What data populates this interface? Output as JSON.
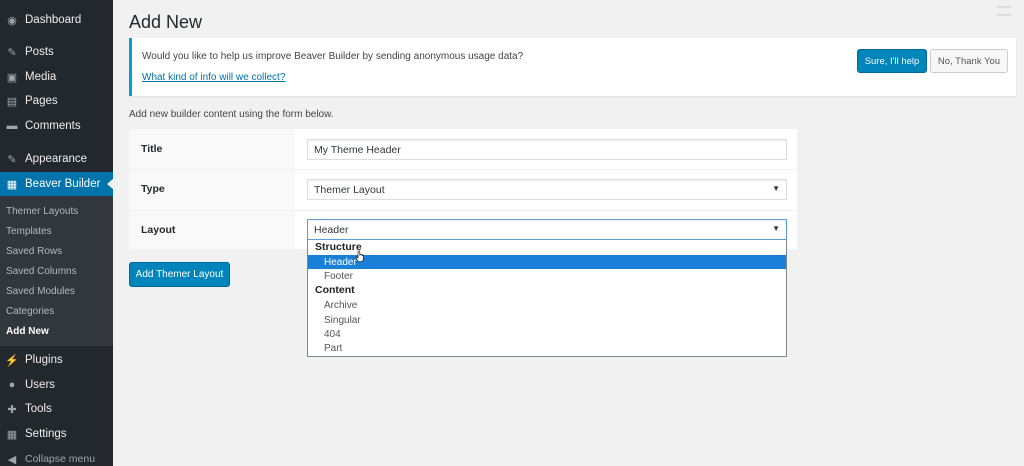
{
  "sidebar": {
    "items": [
      {
        "label": "Dashboard",
        "icon": "dashboard-icon",
        "glyph": "◉"
      },
      {
        "label": "Posts",
        "icon": "pin-icon",
        "glyph": "✎"
      },
      {
        "label": "Media",
        "icon": "media-icon",
        "glyph": "▣"
      },
      {
        "label": "Pages",
        "icon": "pages-icon",
        "glyph": "▤"
      },
      {
        "label": "Comments",
        "icon": "comment-icon",
        "glyph": "▬"
      },
      {
        "label": "Appearance",
        "icon": "brush-icon",
        "glyph": "✎"
      },
      {
        "label": "Beaver Builder",
        "icon": "calendar-icon",
        "glyph": "▦"
      },
      {
        "label": "Plugins",
        "icon": "plug-icon",
        "glyph": "⚡"
      },
      {
        "label": "Users",
        "icon": "user-icon",
        "glyph": "●"
      },
      {
        "label": "Tools",
        "icon": "wrench-icon",
        "glyph": "✚"
      },
      {
        "label": "Settings",
        "icon": "settings-icon",
        "glyph": "▦"
      }
    ],
    "submenu": [
      {
        "label": "Themer Layouts"
      },
      {
        "label": "Templates"
      },
      {
        "label": "Saved Rows"
      },
      {
        "label": "Saved Columns"
      },
      {
        "label": "Saved Modules"
      },
      {
        "label": "Categories"
      },
      {
        "label": "Add New"
      }
    ],
    "collapse_label": "Collapse menu",
    "collapse_glyph": "◀"
  },
  "page": {
    "title": "Add New"
  },
  "notice": {
    "text": "Would you like to help us improve Beaver Builder by sending anonymous usage data?",
    "link": "What kind of info will we collect?",
    "sure_label": "Sure, I'll help",
    "no_label": "No, Thank You"
  },
  "form": {
    "intro": "Add new builder content using the form below.",
    "title_label": "Title",
    "title_value": "My Theme Header",
    "type_label": "Type",
    "type_value": "Themer Layout",
    "layout_label": "Layout",
    "layout_value": "Header",
    "submit_label": "Add Themer Layout"
  },
  "dropdown": {
    "groups": [
      {
        "label": "Structure",
        "options": [
          "Header",
          "Footer"
        ]
      },
      {
        "label": "Content",
        "options": [
          "Archive",
          "Singular",
          "404",
          "Part"
        ]
      }
    ],
    "selected": "Header"
  },
  "colors": {
    "sidebar_bg": "#23282d",
    "active_blue": "#0073aa",
    "button_blue": "#0085ba",
    "notice_border": "#00a0d2"
  }
}
